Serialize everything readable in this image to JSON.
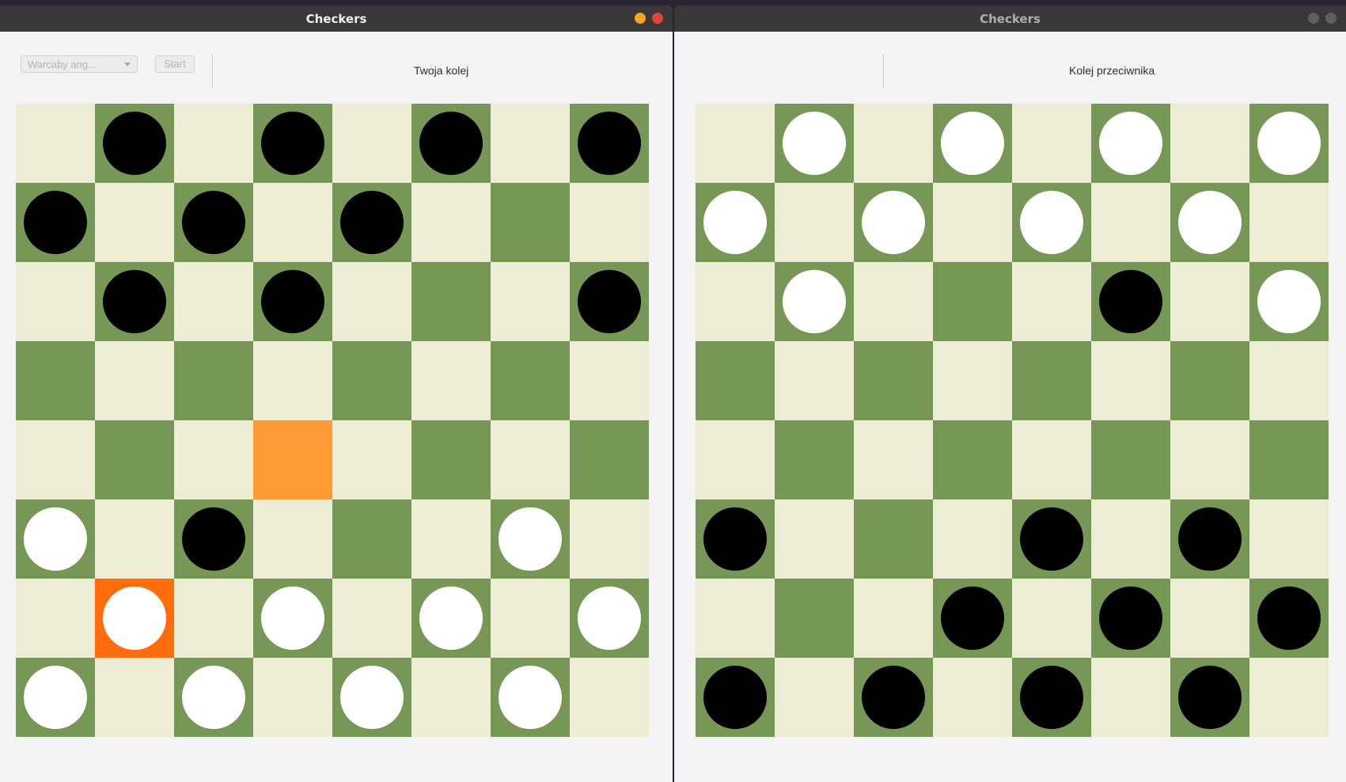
{
  "windows": [
    {
      "title": "Checkers",
      "toolbar": {
        "variant_select": "Warcaby ang...",
        "start_label": "Start"
      },
      "status": "Twoja kolej",
      "board": [
        [
          null,
          "b",
          null,
          "b",
          null,
          "b",
          null,
          "b"
        ],
        [
          "b",
          null,
          "b",
          null,
          "b",
          null,
          null,
          null
        ],
        [
          null,
          "b",
          null,
          "b",
          null,
          null,
          null,
          "b"
        ],
        [
          null,
          null,
          null,
          null,
          null,
          null,
          null,
          null
        ],
        [
          null,
          null,
          null,
          null,
          null,
          null,
          null,
          null
        ],
        [
          "w",
          null,
          "b",
          null,
          null,
          null,
          "w",
          null
        ],
        [
          null,
          "w",
          null,
          "w",
          null,
          "w",
          null,
          "w"
        ],
        [
          "w",
          null,
          "w",
          null,
          "w",
          null,
          "w",
          null
        ]
      ],
      "highlights": [
        {
          "row": 4,
          "col": 3,
          "kind": "target"
        },
        {
          "row": 6,
          "col": 1,
          "kind": "selected"
        }
      ]
    },
    {
      "title": "Checkers",
      "status": "Kolej przeciwnika",
      "board": [
        [
          null,
          "w",
          null,
          "w",
          null,
          "w",
          null,
          "w"
        ],
        [
          "w",
          null,
          "w",
          null,
          "w",
          null,
          "w",
          null
        ],
        [
          null,
          "w",
          null,
          null,
          null,
          "b",
          null,
          "w"
        ],
        [
          null,
          null,
          null,
          null,
          null,
          null,
          null,
          null
        ],
        [
          null,
          null,
          null,
          null,
          null,
          null,
          null,
          null
        ],
        [
          "b",
          null,
          null,
          null,
          "b",
          null,
          "b",
          null
        ],
        [
          null,
          null,
          null,
          "b",
          null,
          "b",
          null,
          "b"
        ],
        [
          "b",
          null,
          "b",
          null,
          "b",
          null,
          "b",
          null
        ]
      ],
      "highlights": []
    }
  ],
  "colors": {
    "light_square": "#ededd6",
    "dark_square": "#779756",
    "highlight_target": "#fe9b37",
    "highlight_selected": "#fe6c0b",
    "black_piece": "#000000",
    "white_piece": "#ffffff"
  }
}
